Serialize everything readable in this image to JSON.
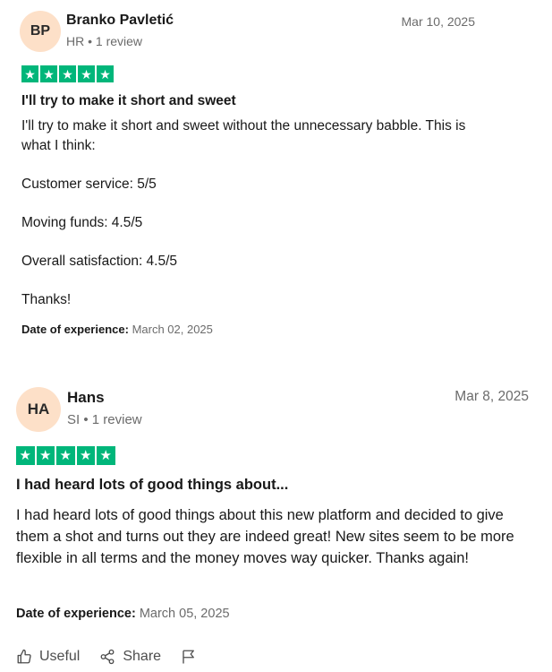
{
  "reviews": [
    {
      "initials": "BP",
      "name": "Branko Pavletić",
      "meta": "HR • 1 review",
      "date": "Mar 10, 2025",
      "rating": 5,
      "title": "I'll try to make it short and sweet",
      "body": [
        "I'll try to make it short and sweet without the unnecessary babble. This is what I think:",
        "Customer service: 5/5",
        "Moving funds: 4.5/5",
        "Overall satisfaction: 4.5/5",
        "Thanks!"
      ],
      "experience_label": "Date of experience:",
      "experience_date": "March 02, 2025"
    },
    {
      "initials": "HA",
      "name": "Hans",
      "meta": "SI • 1 review",
      "date": "Mar 8, 2025",
      "rating": 5,
      "title": "I had heard lots of good things about...",
      "body": [
        "I had heard lots of good things about this new platform and decided to give them a shot and turns out they are indeed great! New sites seem to be more flexible in all terms and the money moves way quicker. Thanks again!"
      ],
      "experience_label": "Date of experience:",
      "experience_date": "March 05, 2025"
    }
  ],
  "actions": {
    "useful_label": "Useful",
    "share_label": "Share",
    "useful_icon": "thumbs-up-icon",
    "share_icon": "share-icon",
    "flag_icon": "flag-icon"
  },
  "colors": {
    "star_green": "#00b67a",
    "avatar_bg": "#fde0c8"
  }
}
